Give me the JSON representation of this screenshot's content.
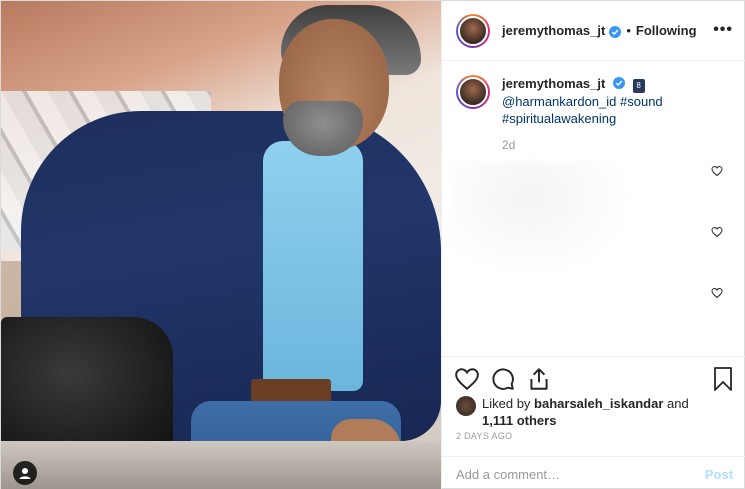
{
  "post": {
    "header": {
      "username": "jeremythomas_jt",
      "separator": "•",
      "follow_status": "Following",
      "more_label": "•••"
    },
    "caption": {
      "username": "jeremythomas_jt",
      "badge": "8",
      "mention": "@harmankardon_id",
      "hashtag1": "#sound",
      "hashtag2": "#spiritualawakening",
      "time": "2d"
    },
    "likes": {
      "prefix": "Liked by",
      "liker": "baharsaleh_iskandar",
      "and": "and",
      "others": "1,111 others"
    },
    "date": "2 DAYS AGO",
    "comment_box": {
      "placeholder": "Add a comment…",
      "post_label": "Post"
    },
    "icons": [
      "heart-icon",
      "comment-icon",
      "share-icon",
      "bookmark-icon",
      "user-tag-icon",
      "verified-icon",
      "more-icon"
    ],
    "colors": {
      "link": "#003569",
      "verified": "#3897f0",
      "post_button_disabled": "#b2dffc",
      "muted": "#999999"
    }
  }
}
